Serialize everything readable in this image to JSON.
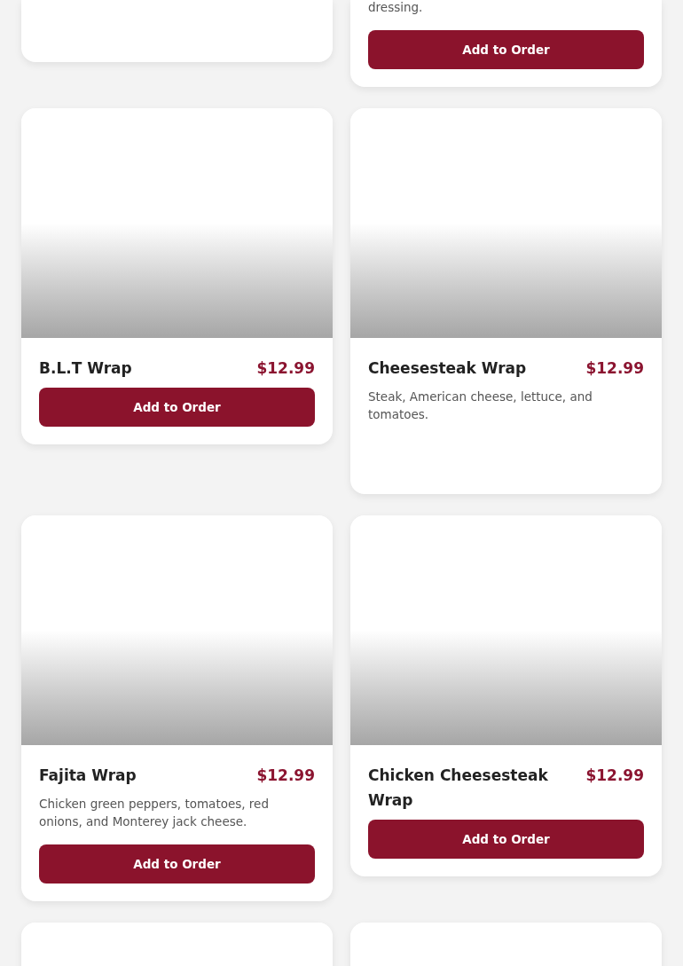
{
  "menu_items": [
    {
      "kind": "tail"
    },
    {
      "kind": "tail",
      "description": "dressing.",
      "button": "Add to Order"
    },
    {
      "kind": "full",
      "name": "B.L.T Wrap",
      "price": "$12.99",
      "button": "Add to Order"
    },
    {
      "kind": "full",
      "name": "Cheesesteak Wrap",
      "price": "$12.99",
      "description": "Steak, American cheese, lettuce, and tomatoes."
    },
    {
      "kind": "full",
      "name": "Fajita Wrap",
      "price": "$12.99",
      "description": "Chicken green peppers, tomatoes, red onions, and Monterey jack cheese.",
      "button": "Add to Order"
    },
    {
      "kind": "full",
      "name": "Chicken Cheesesteak Wrap",
      "price": "$12.99",
      "button": "Add to Order"
    },
    {
      "kind": "head"
    },
    {
      "kind": "head"
    }
  ]
}
